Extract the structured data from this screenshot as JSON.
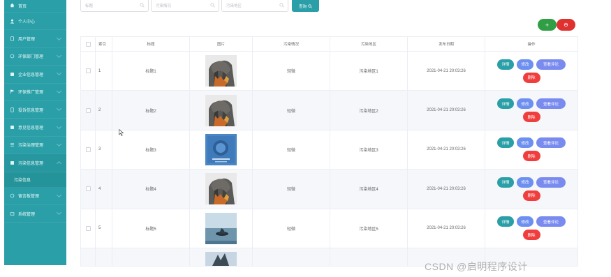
{
  "sidebar": {
    "items": [
      {
        "label": "首页",
        "icon": "home-icon"
      },
      {
        "label": "个人中心",
        "icon": "user-icon"
      },
      {
        "label": "用户管理",
        "icon": "users-icon"
      },
      {
        "label": "环保部门管理",
        "icon": "department-icon"
      },
      {
        "label": "企业信息管理",
        "icon": "building-icon"
      },
      {
        "label": "环保推广管理",
        "icon": "flag-icon"
      },
      {
        "label": "投诉信息管理",
        "icon": "document-icon"
      },
      {
        "label": "意见信息管理",
        "icon": "comment-icon"
      },
      {
        "label": "污染治理管理",
        "icon": "list-icon"
      },
      {
        "label": "污染信息管理",
        "icon": "grid-icon"
      },
      {
        "label": "污染信息",
        "icon": ""
      },
      {
        "label": "留言板管理",
        "icon": "message-icon"
      },
      {
        "label": "系统管理",
        "icon": "settings-icon"
      }
    ]
  },
  "search": {
    "title_placeholder": "标题",
    "situation_placeholder": "污染情况",
    "area_placeholder": "污染地区",
    "query_label": "查询"
  },
  "actions": {
    "add_label": "+",
    "delete_label": "⊖"
  },
  "table": {
    "headers": {
      "index": "索引",
      "title": "标题",
      "image": "图片",
      "situation": "污染情况",
      "area": "污染地区",
      "date": "发布日期",
      "ops": "操作"
    },
    "op_labels": {
      "detail": "详情",
      "edit": "修改",
      "review": "查看评论",
      "delete": "删除"
    },
    "rows": [
      {
        "index": "1",
        "title": "标题1",
        "situation": "轻微",
        "area": "污染地区1",
        "date": "2021-04-21 20:03:26",
        "image": "smoke-stacks"
      },
      {
        "index": "2",
        "title": "标题2",
        "situation": "轻微",
        "area": "污染地区2",
        "date": "2021-04-21 20:03:26",
        "image": "smoke-stacks"
      },
      {
        "index": "3",
        "title": "标题3",
        "situation": "轻微",
        "area": "污染地区3",
        "date": "2021-04-21 20:03:26",
        "image": "blue-poster"
      },
      {
        "index": "4",
        "title": "标题4",
        "situation": "轻微",
        "area": "污染地区4",
        "date": "2021-04-21 20:03:26",
        "image": "smoke-stacks"
      },
      {
        "index": "5",
        "title": "标题5",
        "situation": "轻微",
        "area": "污染地区5",
        "date": "2021-04-21 20:03:26",
        "image": "island-sea"
      }
    ]
  },
  "watermark": "CSDN @启明程序设计",
  "colors": {
    "teal": "#2a9fa7",
    "green": "#2f9e44",
    "red": "#e03131",
    "blue": "#6c8ff0"
  }
}
